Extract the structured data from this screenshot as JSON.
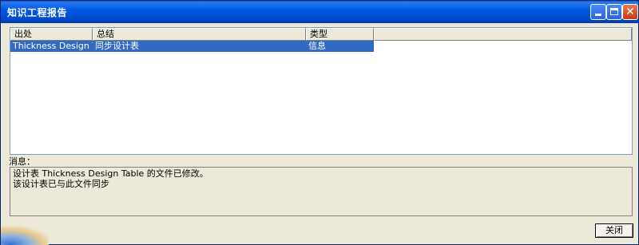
{
  "window": {
    "title": "知识工程报告"
  },
  "table": {
    "columns": [
      {
        "label": "出处"
      },
      {
        "label": "总结"
      },
      {
        "label": "类型"
      }
    ],
    "rows": [
      {
        "source": "Thickness Design T...",
        "summary": "同步设计表",
        "type": "信息",
        "selected": true
      }
    ]
  },
  "message": {
    "label": "消息：",
    "lines": [
      "设计表 Thickness Design Table 的文件已修改。",
      "该设计表已与此文件同步"
    ]
  },
  "buttons": {
    "close_label": "关闭"
  },
  "icons": {
    "minimize": "minimize-icon",
    "maximize": "maximize-icon",
    "close": "close-icon"
  },
  "colors": {
    "titlebar": "#0058e6",
    "selection": "#316ac5",
    "face": "#ece9d8"
  }
}
